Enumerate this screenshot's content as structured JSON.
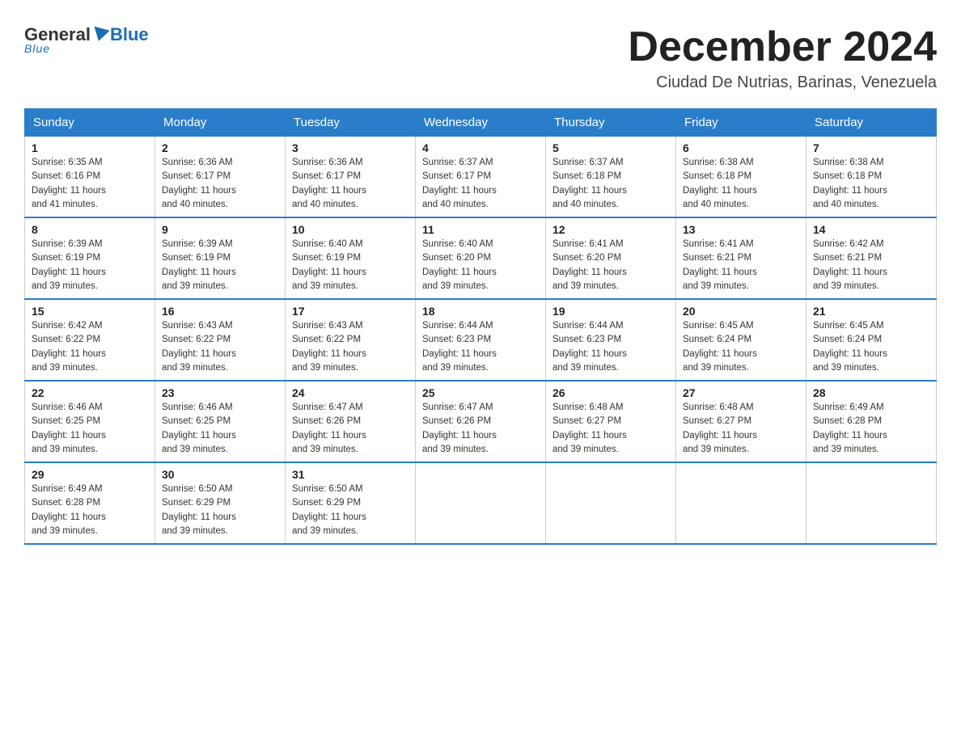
{
  "header": {
    "logo_general": "General",
    "logo_blue": "Blue",
    "month_year": "December 2024",
    "location": "Ciudad De Nutrias, Barinas, Venezuela"
  },
  "days_of_week": [
    "Sunday",
    "Monday",
    "Tuesday",
    "Wednesday",
    "Thursday",
    "Friday",
    "Saturday"
  ],
  "weeks": [
    [
      {
        "day": "1",
        "sunrise": "6:35 AM",
        "sunset": "6:16 PM",
        "daylight": "11 hours and 41 minutes."
      },
      {
        "day": "2",
        "sunrise": "6:36 AM",
        "sunset": "6:17 PM",
        "daylight": "11 hours and 40 minutes."
      },
      {
        "day": "3",
        "sunrise": "6:36 AM",
        "sunset": "6:17 PM",
        "daylight": "11 hours and 40 minutes."
      },
      {
        "day": "4",
        "sunrise": "6:37 AM",
        "sunset": "6:17 PM",
        "daylight": "11 hours and 40 minutes."
      },
      {
        "day": "5",
        "sunrise": "6:37 AM",
        "sunset": "6:18 PM",
        "daylight": "11 hours and 40 minutes."
      },
      {
        "day": "6",
        "sunrise": "6:38 AM",
        "sunset": "6:18 PM",
        "daylight": "11 hours and 40 minutes."
      },
      {
        "day": "7",
        "sunrise": "6:38 AM",
        "sunset": "6:18 PM",
        "daylight": "11 hours and 40 minutes."
      }
    ],
    [
      {
        "day": "8",
        "sunrise": "6:39 AM",
        "sunset": "6:19 PM",
        "daylight": "11 hours and 39 minutes."
      },
      {
        "day": "9",
        "sunrise": "6:39 AM",
        "sunset": "6:19 PM",
        "daylight": "11 hours and 39 minutes."
      },
      {
        "day": "10",
        "sunrise": "6:40 AM",
        "sunset": "6:19 PM",
        "daylight": "11 hours and 39 minutes."
      },
      {
        "day": "11",
        "sunrise": "6:40 AM",
        "sunset": "6:20 PM",
        "daylight": "11 hours and 39 minutes."
      },
      {
        "day": "12",
        "sunrise": "6:41 AM",
        "sunset": "6:20 PM",
        "daylight": "11 hours and 39 minutes."
      },
      {
        "day": "13",
        "sunrise": "6:41 AM",
        "sunset": "6:21 PM",
        "daylight": "11 hours and 39 minutes."
      },
      {
        "day": "14",
        "sunrise": "6:42 AM",
        "sunset": "6:21 PM",
        "daylight": "11 hours and 39 minutes."
      }
    ],
    [
      {
        "day": "15",
        "sunrise": "6:42 AM",
        "sunset": "6:22 PM",
        "daylight": "11 hours and 39 minutes."
      },
      {
        "day": "16",
        "sunrise": "6:43 AM",
        "sunset": "6:22 PM",
        "daylight": "11 hours and 39 minutes."
      },
      {
        "day": "17",
        "sunrise": "6:43 AM",
        "sunset": "6:22 PM",
        "daylight": "11 hours and 39 minutes."
      },
      {
        "day": "18",
        "sunrise": "6:44 AM",
        "sunset": "6:23 PM",
        "daylight": "11 hours and 39 minutes."
      },
      {
        "day": "19",
        "sunrise": "6:44 AM",
        "sunset": "6:23 PM",
        "daylight": "11 hours and 39 minutes."
      },
      {
        "day": "20",
        "sunrise": "6:45 AM",
        "sunset": "6:24 PM",
        "daylight": "11 hours and 39 minutes."
      },
      {
        "day": "21",
        "sunrise": "6:45 AM",
        "sunset": "6:24 PM",
        "daylight": "11 hours and 39 minutes."
      }
    ],
    [
      {
        "day": "22",
        "sunrise": "6:46 AM",
        "sunset": "6:25 PM",
        "daylight": "11 hours and 39 minutes."
      },
      {
        "day": "23",
        "sunrise": "6:46 AM",
        "sunset": "6:25 PM",
        "daylight": "11 hours and 39 minutes."
      },
      {
        "day": "24",
        "sunrise": "6:47 AM",
        "sunset": "6:26 PM",
        "daylight": "11 hours and 39 minutes."
      },
      {
        "day": "25",
        "sunrise": "6:47 AM",
        "sunset": "6:26 PM",
        "daylight": "11 hours and 39 minutes."
      },
      {
        "day": "26",
        "sunrise": "6:48 AM",
        "sunset": "6:27 PM",
        "daylight": "11 hours and 39 minutes."
      },
      {
        "day": "27",
        "sunrise": "6:48 AM",
        "sunset": "6:27 PM",
        "daylight": "11 hours and 39 minutes."
      },
      {
        "day": "28",
        "sunrise": "6:49 AM",
        "sunset": "6:28 PM",
        "daylight": "11 hours and 39 minutes."
      }
    ],
    [
      {
        "day": "29",
        "sunrise": "6:49 AM",
        "sunset": "6:28 PM",
        "daylight": "11 hours and 39 minutes."
      },
      {
        "day": "30",
        "sunrise": "6:50 AM",
        "sunset": "6:29 PM",
        "daylight": "11 hours and 39 minutes."
      },
      {
        "day": "31",
        "sunrise": "6:50 AM",
        "sunset": "6:29 PM",
        "daylight": "11 hours and 39 minutes."
      },
      null,
      null,
      null,
      null
    ]
  ],
  "labels": {
    "sunrise": "Sunrise:",
    "sunset": "Sunset:",
    "daylight": "Daylight:"
  }
}
